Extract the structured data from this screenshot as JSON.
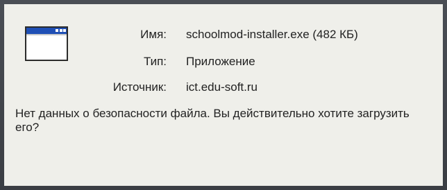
{
  "dialog": {
    "icon": "application-window-icon",
    "fields": [
      {
        "label": "Имя:",
        "value": "schoolmod-installer.exe (482 КБ)"
      },
      {
        "label": "Тип:",
        "value": "Приложение"
      },
      {
        "label": "Источник:",
        "value": "ict.edu-soft.ru"
      }
    ],
    "warning_text": "Нет данных о безопасности файла. Вы действительно хотите загрузить его?"
  },
  "colors": {
    "background": "#3b3f45",
    "panel": "#efefea",
    "icon_titlebar": "#1f4fb5"
  }
}
